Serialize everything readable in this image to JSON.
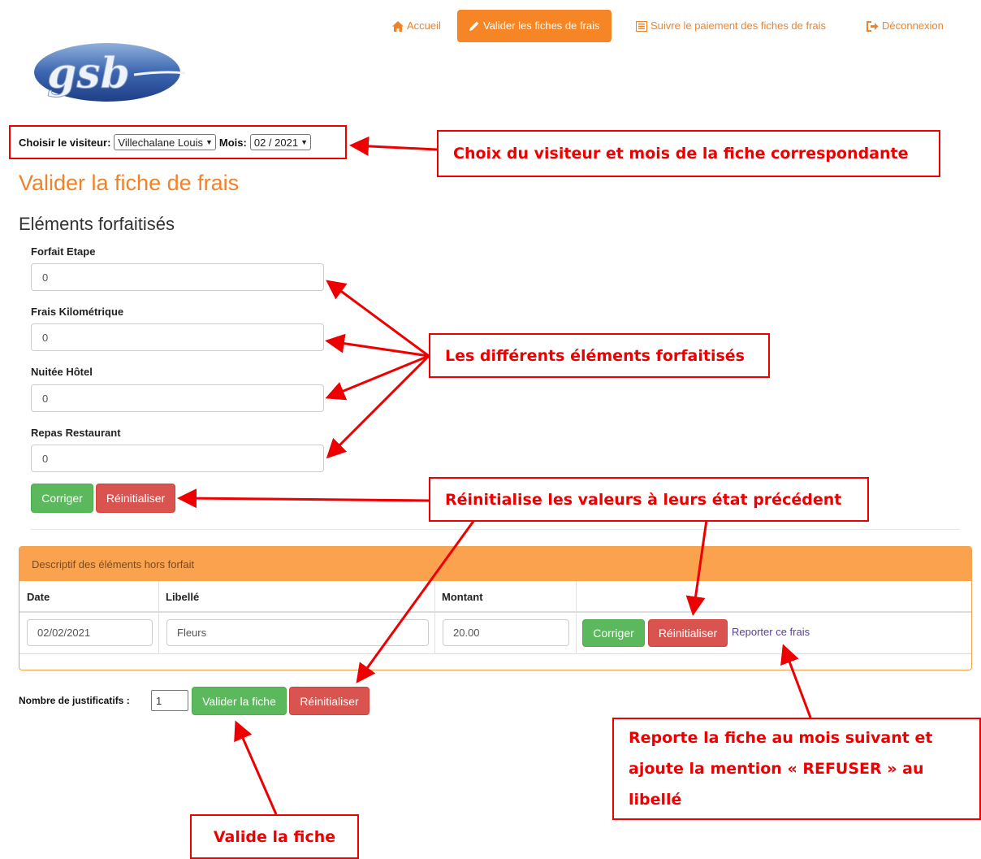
{
  "nav": {
    "home": "Accueil",
    "validate": "Valider les fiches de frais",
    "follow": "Suivre le paiement des fiches de frais",
    "logout": "Déconnexion"
  },
  "logo": {
    "text": "gsb"
  },
  "selection": {
    "visitor_label": "Choisir le visiteur:",
    "visitor_value": "Villechalane Louis",
    "month_label": "Mois:",
    "month_value": "02 / 2021"
  },
  "page_title": "Valider la fiche de frais",
  "forfait": {
    "title": "Eléments forfaitisés",
    "fields": [
      {
        "label": "Forfait Etape",
        "value": "0"
      },
      {
        "label": "Frais Kilométrique",
        "value": "0"
      },
      {
        "label": "Nuitée Hôtel",
        "value": "0"
      },
      {
        "label": "Repas Restaurant",
        "value": "0"
      }
    ],
    "correct_label": "Corriger",
    "reset_label": "Réinitialiser"
  },
  "hors_forfait": {
    "panel_title": "Descriptif des éléments hors forfait",
    "columns": [
      "Date",
      "Libellé",
      "Montant"
    ],
    "rows": [
      {
        "date": "02/02/2021",
        "libelle": "Fleurs",
        "montant": "20.00",
        "correct": "Corriger",
        "reset": "Réinitialiser",
        "report": "Reporter ce frais"
      }
    ]
  },
  "footer": {
    "justif_label": "Nombre de justificatifs :",
    "justif_value": "1",
    "validate_label": "Valider la fiche",
    "reset_label": "Réinitialiser"
  },
  "annotations": {
    "select": "Choix du visiteur et mois de la fiche correspondante",
    "forfait": "Les différents éléments forfaitisés",
    "reset": "Réinitialise les valeurs à leurs état précédent",
    "report": "Reporte la fiche au mois suivant et ajoute la mention « REFUSER » au libellé",
    "validate": "Valide la fiche"
  },
  "colors": {
    "accent": "#f68625",
    "panel_head": "#fba24e",
    "success": "#5cb85c",
    "danger": "#d9534f",
    "annotation": "#ee0000"
  }
}
